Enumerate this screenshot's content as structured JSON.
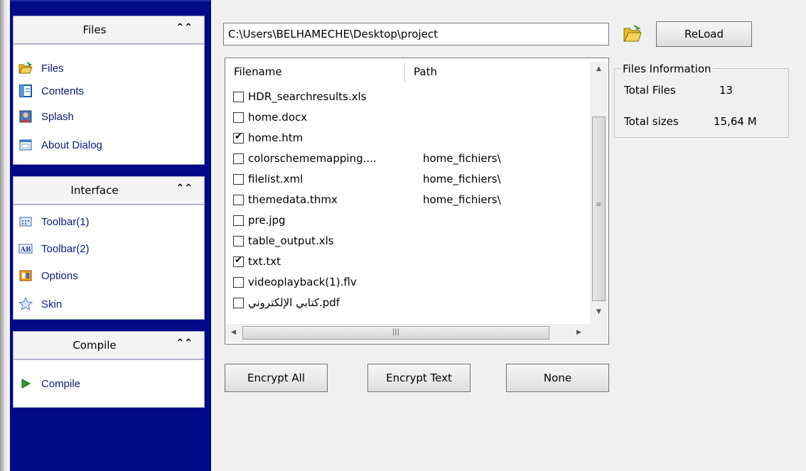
{
  "sidebar": {
    "files": {
      "title": "Files",
      "items": [
        {
          "label": "Files",
          "icon": "folder-open-icon"
        },
        {
          "label": "Contents",
          "icon": "contents-icon"
        },
        {
          "label": "Splash",
          "icon": "splash-icon"
        },
        {
          "label": "About Dialog",
          "icon": "about-dialog-icon"
        }
      ]
    },
    "interface": {
      "title": "Interface",
      "items": [
        {
          "label": "Toolbar(1)",
          "icon": "toolbar-icon"
        },
        {
          "label": "Toolbar(2)",
          "icon": "toolbar-ab-icon"
        },
        {
          "label": "Options",
          "icon": "options-icon"
        },
        {
          "label": "Skin",
          "icon": "star-icon"
        }
      ]
    },
    "compile": {
      "title": "Compile",
      "items": [
        {
          "label": "Compile",
          "icon": "play-icon"
        }
      ]
    }
  },
  "path": {
    "value": "C:\\Users\\BELHAMECHE\\Desktop\\project"
  },
  "toolbar": {
    "reload_label": "ReLoad"
  },
  "file_list": {
    "columns": [
      "Filename",
      "Path"
    ],
    "rows": [
      {
        "name": "HDR_searchresults.xls",
        "path": "",
        "checked": false
      },
      {
        "name": "home.docx",
        "path": "",
        "checked": false
      },
      {
        "name": "home.htm",
        "path": "",
        "checked": true
      },
      {
        "name": "colorschememapping....",
        "path": "home_fichiers\\",
        "checked": false
      },
      {
        "name": "filelist.xml",
        "path": "home_fichiers\\",
        "checked": false
      },
      {
        "name": "themedata.thmx",
        "path": "home_fichiers\\",
        "checked": false
      },
      {
        "name": "pre.jpg",
        "path": "",
        "checked": false
      },
      {
        "name": "table_output.xls",
        "path": "",
        "checked": false
      },
      {
        "name": "txt.txt",
        "path": "",
        "checked": true
      },
      {
        "name": "videoplayback(1).flv",
        "path": "",
        "checked": false
      },
      {
        "name": "كتابي الإلكتروني.pdf",
        "path": "",
        "checked": false
      }
    ]
  },
  "buttons": {
    "encrypt_all": "Encrypt All",
    "encrypt_text": "Encrypt Text",
    "none": "None"
  },
  "info": {
    "legend": "Files Information",
    "total_files_label": "Total Files",
    "total_files_value": "13",
    "total_sizes_label": "Total sizes",
    "total_sizes_value": "15,64 M"
  },
  "colors": {
    "sidebar_bg": "#000a87",
    "nav_text": "#0a1a7a"
  }
}
